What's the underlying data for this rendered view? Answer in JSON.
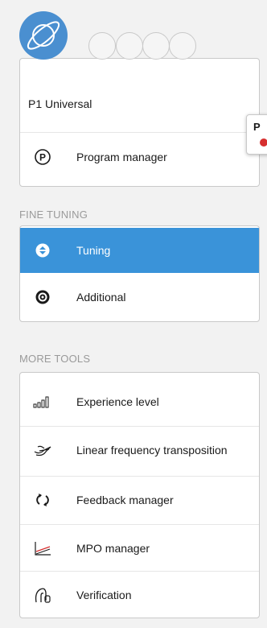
{
  "program": {
    "label": "P1  Universal",
    "manager_label": "Program manager",
    "popover_text": "P"
  },
  "fine_tuning": {
    "title": "FINE TUNING",
    "items": [
      {
        "label": "Tuning",
        "icon": "tuning-icon",
        "active": true
      },
      {
        "label": "Additional",
        "icon": "gear-icon",
        "active": false
      }
    ]
  },
  "more_tools": {
    "title": "MORE TOOLS",
    "items": [
      {
        "label": "Experience level",
        "icon": "signal-bars-icon"
      },
      {
        "label": "Linear frequency transposition",
        "icon": "bird-icon"
      },
      {
        "label": "Feedback manager",
        "icon": "feedback-arrows-icon"
      },
      {
        "label": "MPO manager",
        "icon": "mpo-chart-icon"
      },
      {
        "label": "Verification",
        "icon": "ear-icon"
      }
    ]
  },
  "colors": {
    "accent": "#3a93d9",
    "program_circle": "#4a8fd0",
    "status_dot": "#d62f2f"
  }
}
